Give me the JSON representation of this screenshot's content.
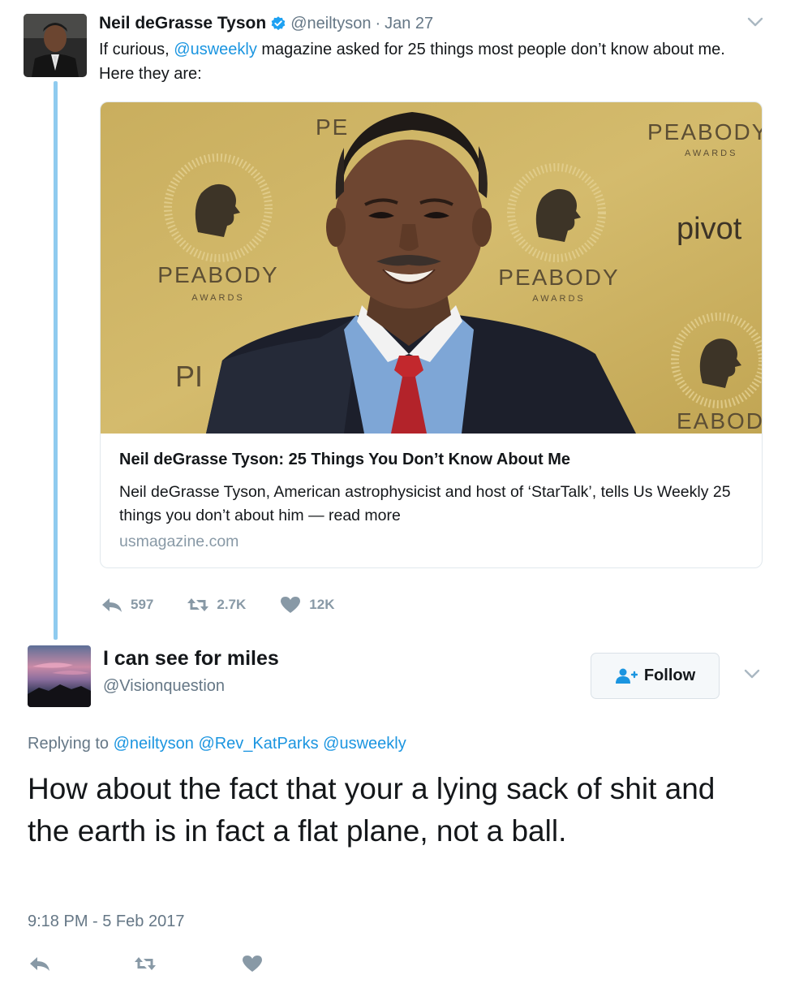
{
  "parent_tweet": {
    "name": "Neil deGrasse Tyson",
    "handle": "@neiltyson",
    "separator": "·",
    "date": "Jan 27",
    "text_before": "If curious, ",
    "mention": "@usweekly",
    "text_after": " magazine asked for 25 things most people don’t know about me. Here they are:",
    "card": {
      "title": "Neil deGrasse Tyson: 25 Things You Don’t Know About Me",
      "description": "Neil deGrasse Tyson, American astrophysicist and host of ‘StarTalk’, tells Us Weekly 25 things you don’t about him — read more",
      "domain": "usmagazine.com",
      "backdrop": {
        "brand_large": "PEABODY",
        "brand_small": "AWARDS",
        "sponsor": "pivot",
        "fragment_pe": "PE",
        "fragment_peabod": "PEABODY",
        "fragment_eabody": "EABODY",
        "fragment_eabod": "EABOD",
        "fragment_pi": "PI"
      }
    },
    "stats": {
      "replies": "597",
      "retweets": "2.7K",
      "likes": "12K"
    }
  },
  "reply_tweet": {
    "name": "I can see for miles",
    "handle": "@Visionquestion",
    "follow_label": "Follow",
    "replying_prefix": "Replying to ",
    "replying_to": [
      "@neiltyson",
      "@Rev_KatParks",
      "@usweekly"
    ],
    "text": "How about the fact that your a lying sack of shit and the earth is in fact a flat plane, not a ball.",
    "timestamp": "9:18 PM - 5 Feb 2017"
  },
  "icons": {
    "verified": "verified-badge-icon",
    "reply": "reply-icon",
    "retweet": "retweet-icon",
    "like": "heart-icon",
    "caret": "chevron-down-icon",
    "follow": "add-user-icon"
  },
  "colors": {
    "link": "#1b95e0",
    "muted": "#657786",
    "action_gray": "#8899a6",
    "thread_line": "#8fcbef",
    "peabody_gold": "#c8ad5c"
  }
}
